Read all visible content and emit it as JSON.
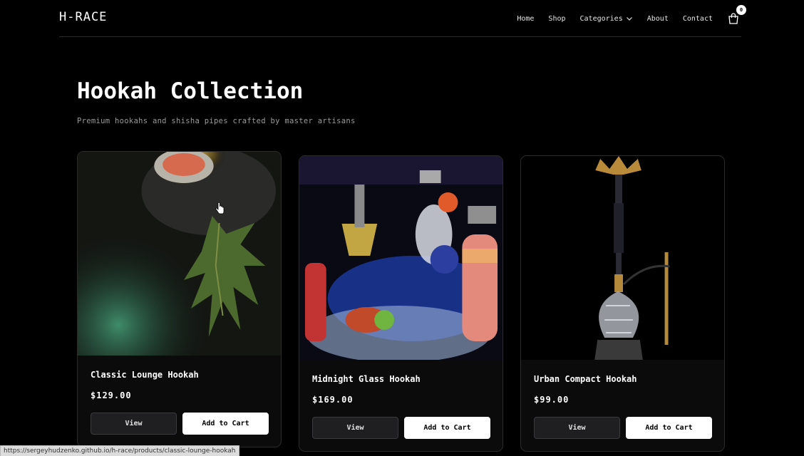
{
  "header": {
    "logo": "H-RACE",
    "nav": [
      "Home",
      "Shop",
      "Categories",
      "About",
      "Contact"
    ],
    "cart_count": "0"
  },
  "main": {
    "title": "Hookah Collection",
    "subtitle": "Premium hookahs and shisha pipes crafted by master artisans"
  },
  "products": [
    {
      "name": "Classic Lounge Hookah",
      "price": "$129.00",
      "view_label": "View",
      "cart_label": "Add to Cart"
    },
    {
      "name": "Midnight Glass Hookah",
      "price": "$169.00",
      "view_label": "View",
      "cart_label": "Add to Cart"
    },
    {
      "name": "Urban Compact Hookah",
      "price": "$99.00",
      "view_label": "View",
      "cart_label": "Add to Cart"
    }
  ],
  "status_bar": {
    "url": "https://sergeyhudzenko.github.io/h-race/products/classic-lounge-hookah"
  },
  "colors": {
    "background": "#000000",
    "card": "#0b0b0b",
    "button_dark": "#1f1f22",
    "button_light": "#ffffff"
  },
  "icons": [
    "chevron-down-icon",
    "shopping-bag-icon",
    "cursor-hand-icon"
  ]
}
